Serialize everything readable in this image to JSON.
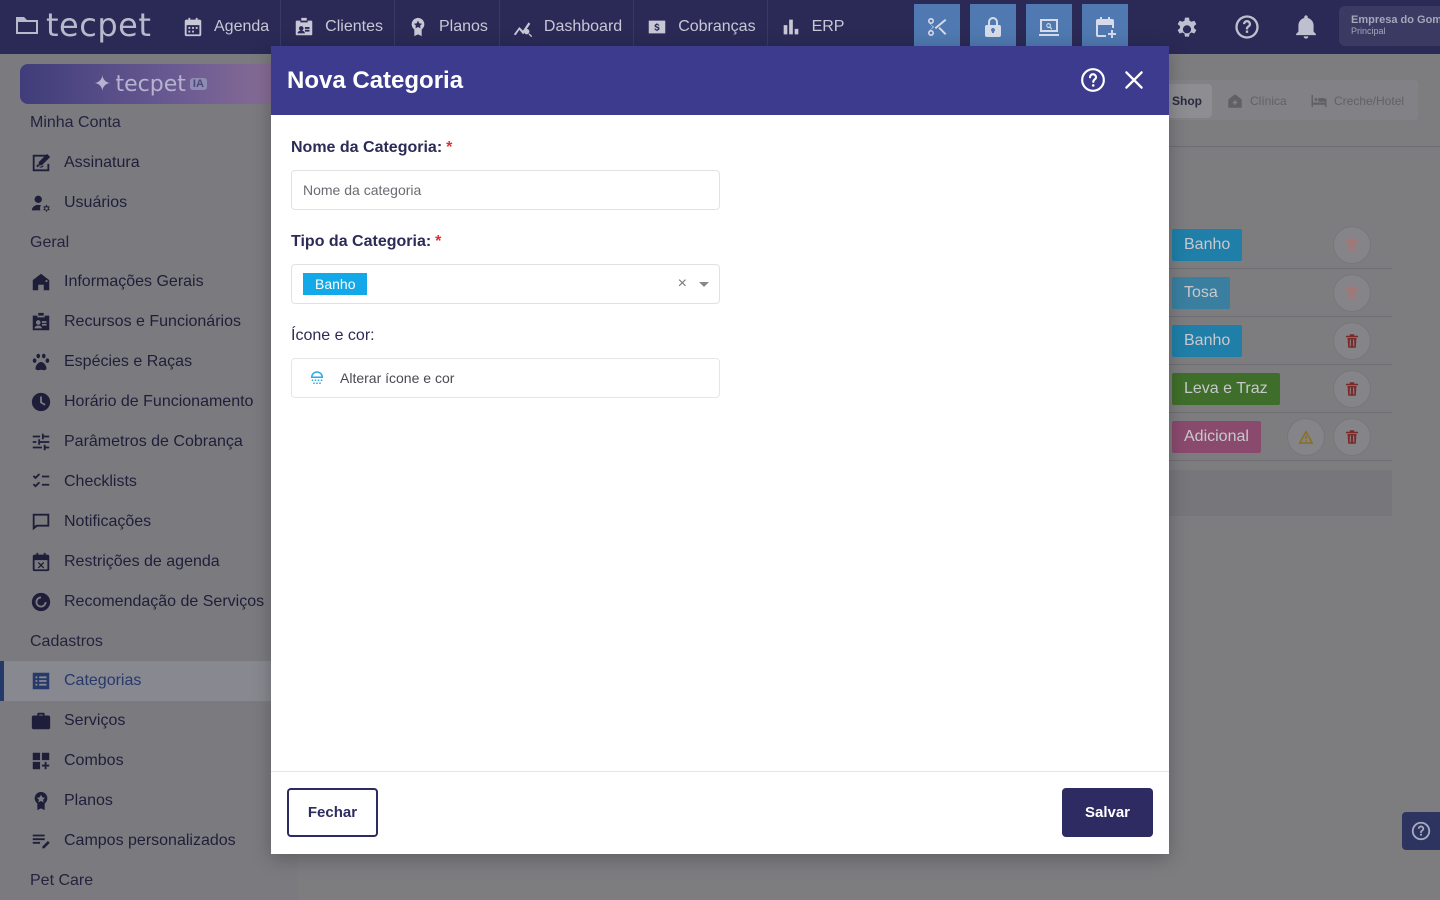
{
  "app": {
    "logo_text": "tecpet"
  },
  "topbar": {
    "nav": [
      {
        "label": "Agenda",
        "icon": "calendar-icon"
      },
      {
        "label": "Clientes",
        "icon": "id-card-icon"
      },
      {
        "label": "Planos",
        "icon": "award-icon"
      },
      {
        "label": "Dashboard",
        "icon": "trend-chart-icon"
      },
      {
        "label": "Cobranças",
        "icon": "dollar-icon"
      },
      {
        "label": "ERP",
        "icon": "bar-chart-icon"
      }
    ],
    "quick_actions": [
      "scissors-icon",
      "lock-icon",
      "monitor-search-icon",
      "calendar-add-icon"
    ],
    "right_icons": [
      "gear-icon",
      "help-icon",
      "bell-icon"
    ],
    "company": {
      "name": "Empresa do Gome",
      "subtitle": "Principal"
    }
  },
  "sidebar": {
    "ia_banner": {
      "text": "tecpet",
      "badge": "IA"
    },
    "sections": {
      "minha_conta": "Minha Conta",
      "geral": "Geral",
      "cadastros": "Cadastros",
      "pet_care": "Pet Care"
    },
    "items": [
      {
        "label": "Assinatura",
        "icon": "signature-icon"
      },
      {
        "label": "Usuários",
        "icon": "users-cog-icon"
      },
      {
        "label": "Informações Gerais",
        "icon": "store-icon"
      },
      {
        "label": "Recursos e Funcionários",
        "icon": "badge-icon"
      },
      {
        "label": "Espécies e Raças",
        "icon": "paw-icon"
      },
      {
        "label": "Horário de Funcionamento",
        "icon": "clock-icon"
      },
      {
        "label": "Parâmetros de Cobrança",
        "icon": "sliders-icon"
      },
      {
        "label": "Checklists",
        "icon": "checklist-icon"
      },
      {
        "label": "Notificações",
        "icon": "notification-icon"
      },
      {
        "label": "Restrições de agenda",
        "icon": "calendar-block-icon"
      },
      {
        "label": "Recomendação de Serviços",
        "icon": "recommend-icon"
      },
      {
        "label": "Categorias",
        "icon": "list-icon",
        "active": true
      },
      {
        "label": "Serviços",
        "icon": "briefcase-icon"
      },
      {
        "label": "Combos",
        "icon": "grid-add-icon"
      },
      {
        "label": "Planos",
        "icon": "award-icon"
      },
      {
        "label": "Campos personalizados",
        "icon": "edit-list-icon"
      }
    ]
  },
  "background": {
    "tabs": [
      {
        "label": "Shop",
        "active": true
      },
      {
        "label": "Clínica",
        "icon": "clinic-icon"
      },
      {
        "label": "Creche/Hotel",
        "icon": "hotel-icon"
      }
    ],
    "rows": [
      {
        "chip": "Banho",
        "color": "#1f7fa8"
      },
      {
        "chip": "Tosa",
        "color": "#3a7fa0"
      },
      {
        "chip": "Banho",
        "color": "#1f7fa8"
      },
      {
        "chip": "Leva e Traz",
        "color": "#3f6e2a"
      },
      {
        "chip": "Adicional",
        "color": "#8a4a6e",
        "warning": true
      }
    ]
  },
  "modal": {
    "title": "Nova Categoria",
    "name_field": {
      "label": "Nome da Categoria:",
      "required_mark": "*",
      "placeholder": "Nome da categoria",
      "value": ""
    },
    "type_field": {
      "label": "Tipo da Categoria:",
      "required_mark": "*",
      "selected": "Banho",
      "clear": "×"
    },
    "icon_field": {
      "label": "Ícone e cor:",
      "button_label": "Alterar ícone e cor"
    },
    "footer": {
      "close_label": "Fechar",
      "save_label": "Salvar"
    }
  }
}
